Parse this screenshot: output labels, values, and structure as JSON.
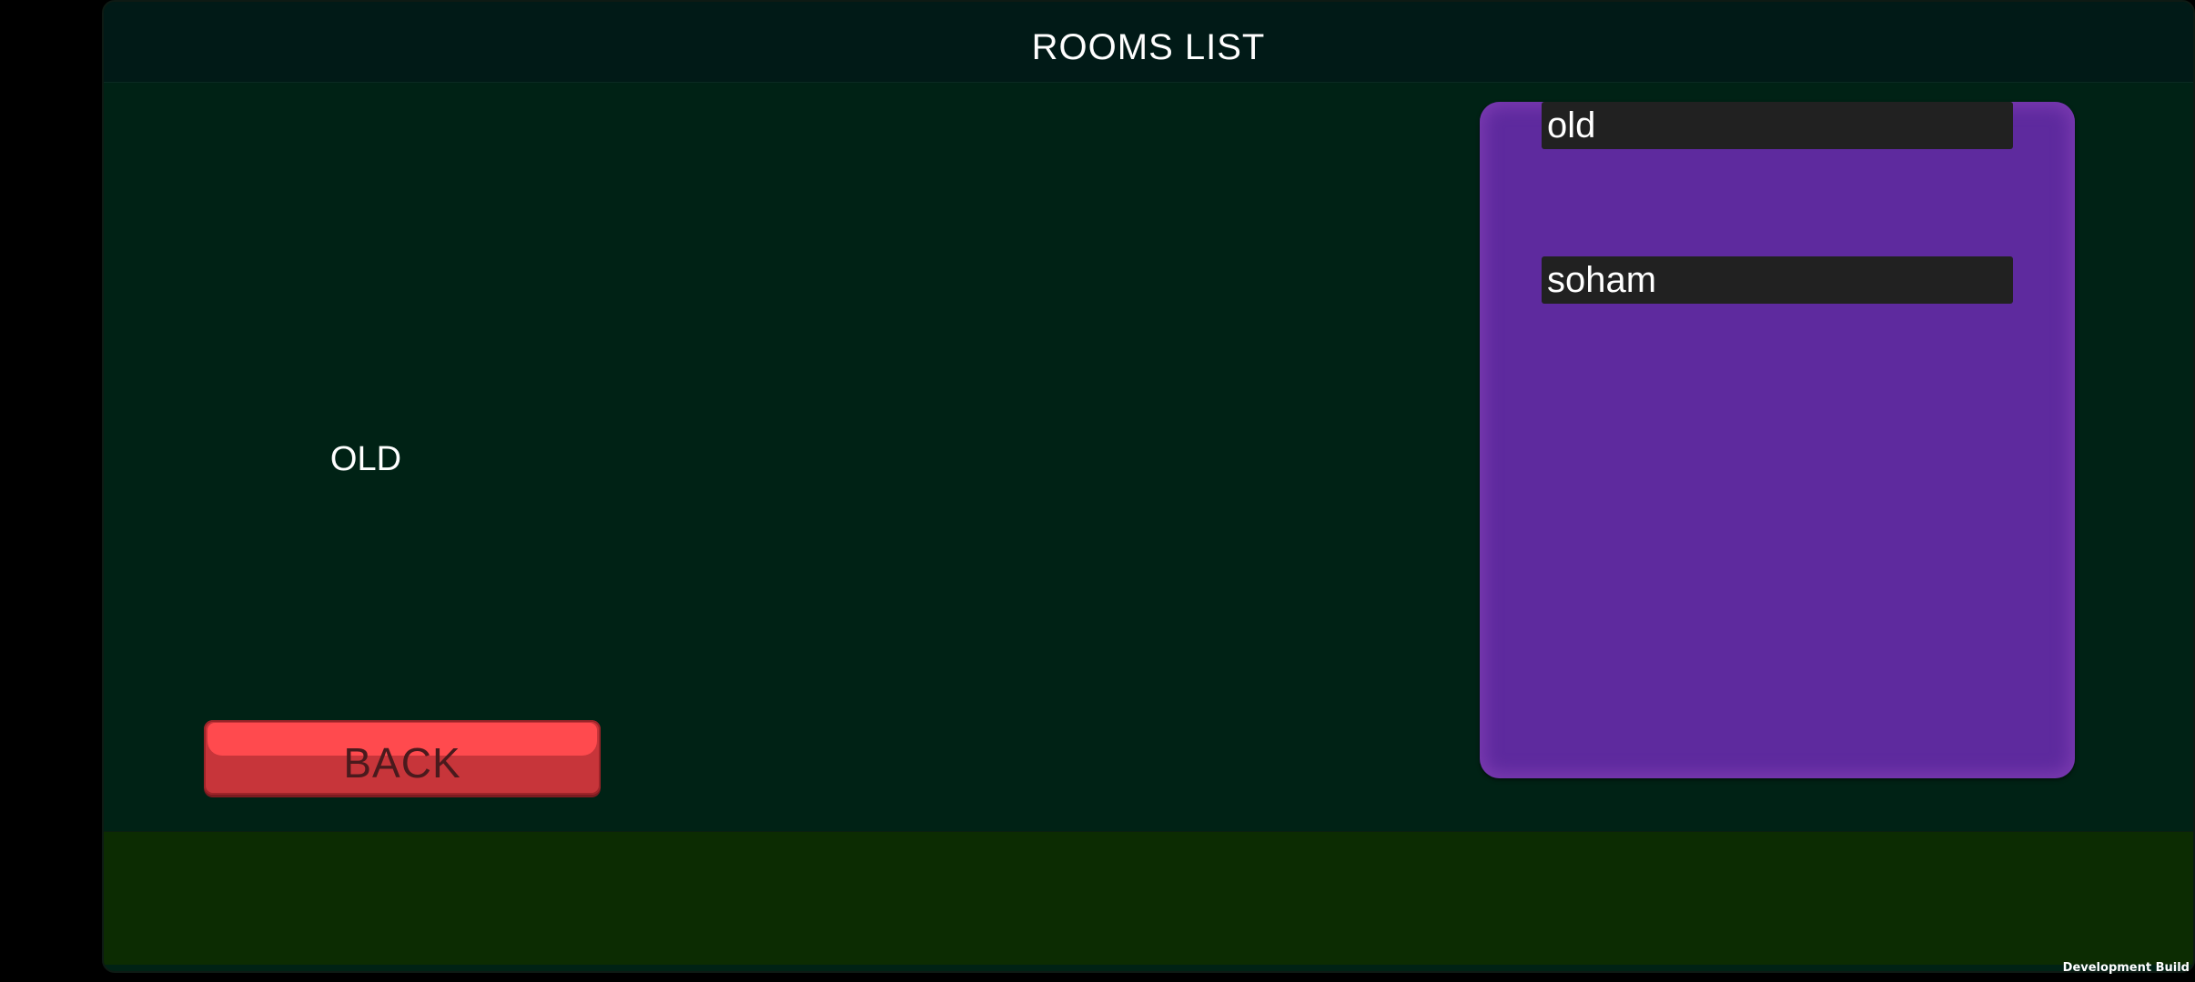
{
  "header": {
    "title": "ROOMS LIST"
  },
  "selected_room": {
    "name": "OLD"
  },
  "back_button": {
    "label": "BACK"
  },
  "room_list": {
    "items": [
      {
        "name": "old"
      },
      {
        "name": "soham"
      }
    ]
  },
  "footer": {
    "dev_build_label": "Development Build"
  },
  "colors": {
    "background": "#002215",
    "header": "#011a17",
    "footer": "#0c2c02",
    "room_list_panel": "#5e2a9e",
    "room_item": "#212121",
    "back_button": "#ff4a4e"
  }
}
